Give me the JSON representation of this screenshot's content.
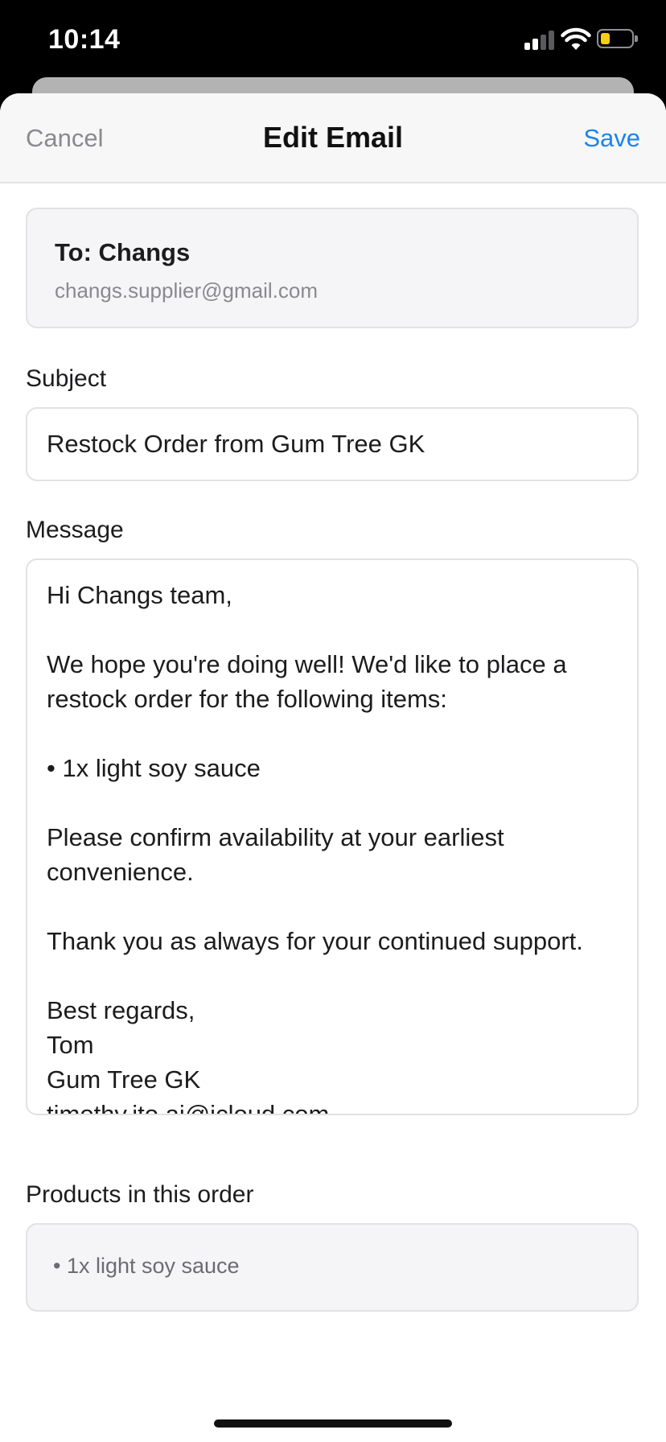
{
  "status_bar": {
    "time": "10:14",
    "battery_color": "#f7ce16"
  },
  "nav": {
    "cancel_label": "Cancel",
    "title": "Edit Email",
    "save_label": "Save",
    "accent_color": "#1a84ea"
  },
  "recipient": {
    "to_label": "To: Changs",
    "email": "changs.supplier@gmail.com"
  },
  "subject": {
    "label": "Subject",
    "value": "Restock Order from Gum Tree GK"
  },
  "message": {
    "label": "Message",
    "body": "Hi Changs team,\n\nWe hope you're doing well! We'd like to place a\nrestock order for the following items:\n\n• 1x light soy sauce\n\nPlease confirm availability at your earliest\nconvenience.\n\nThank you as always for your continued support.\n\nBest regards,\nTom\nGum Tree GK\ntimothy.ito.ai@icloud.com"
  },
  "products": {
    "label": "Products in this order",
    "items": [
      "• 1x light soy sauce"
    ]
  }
}
